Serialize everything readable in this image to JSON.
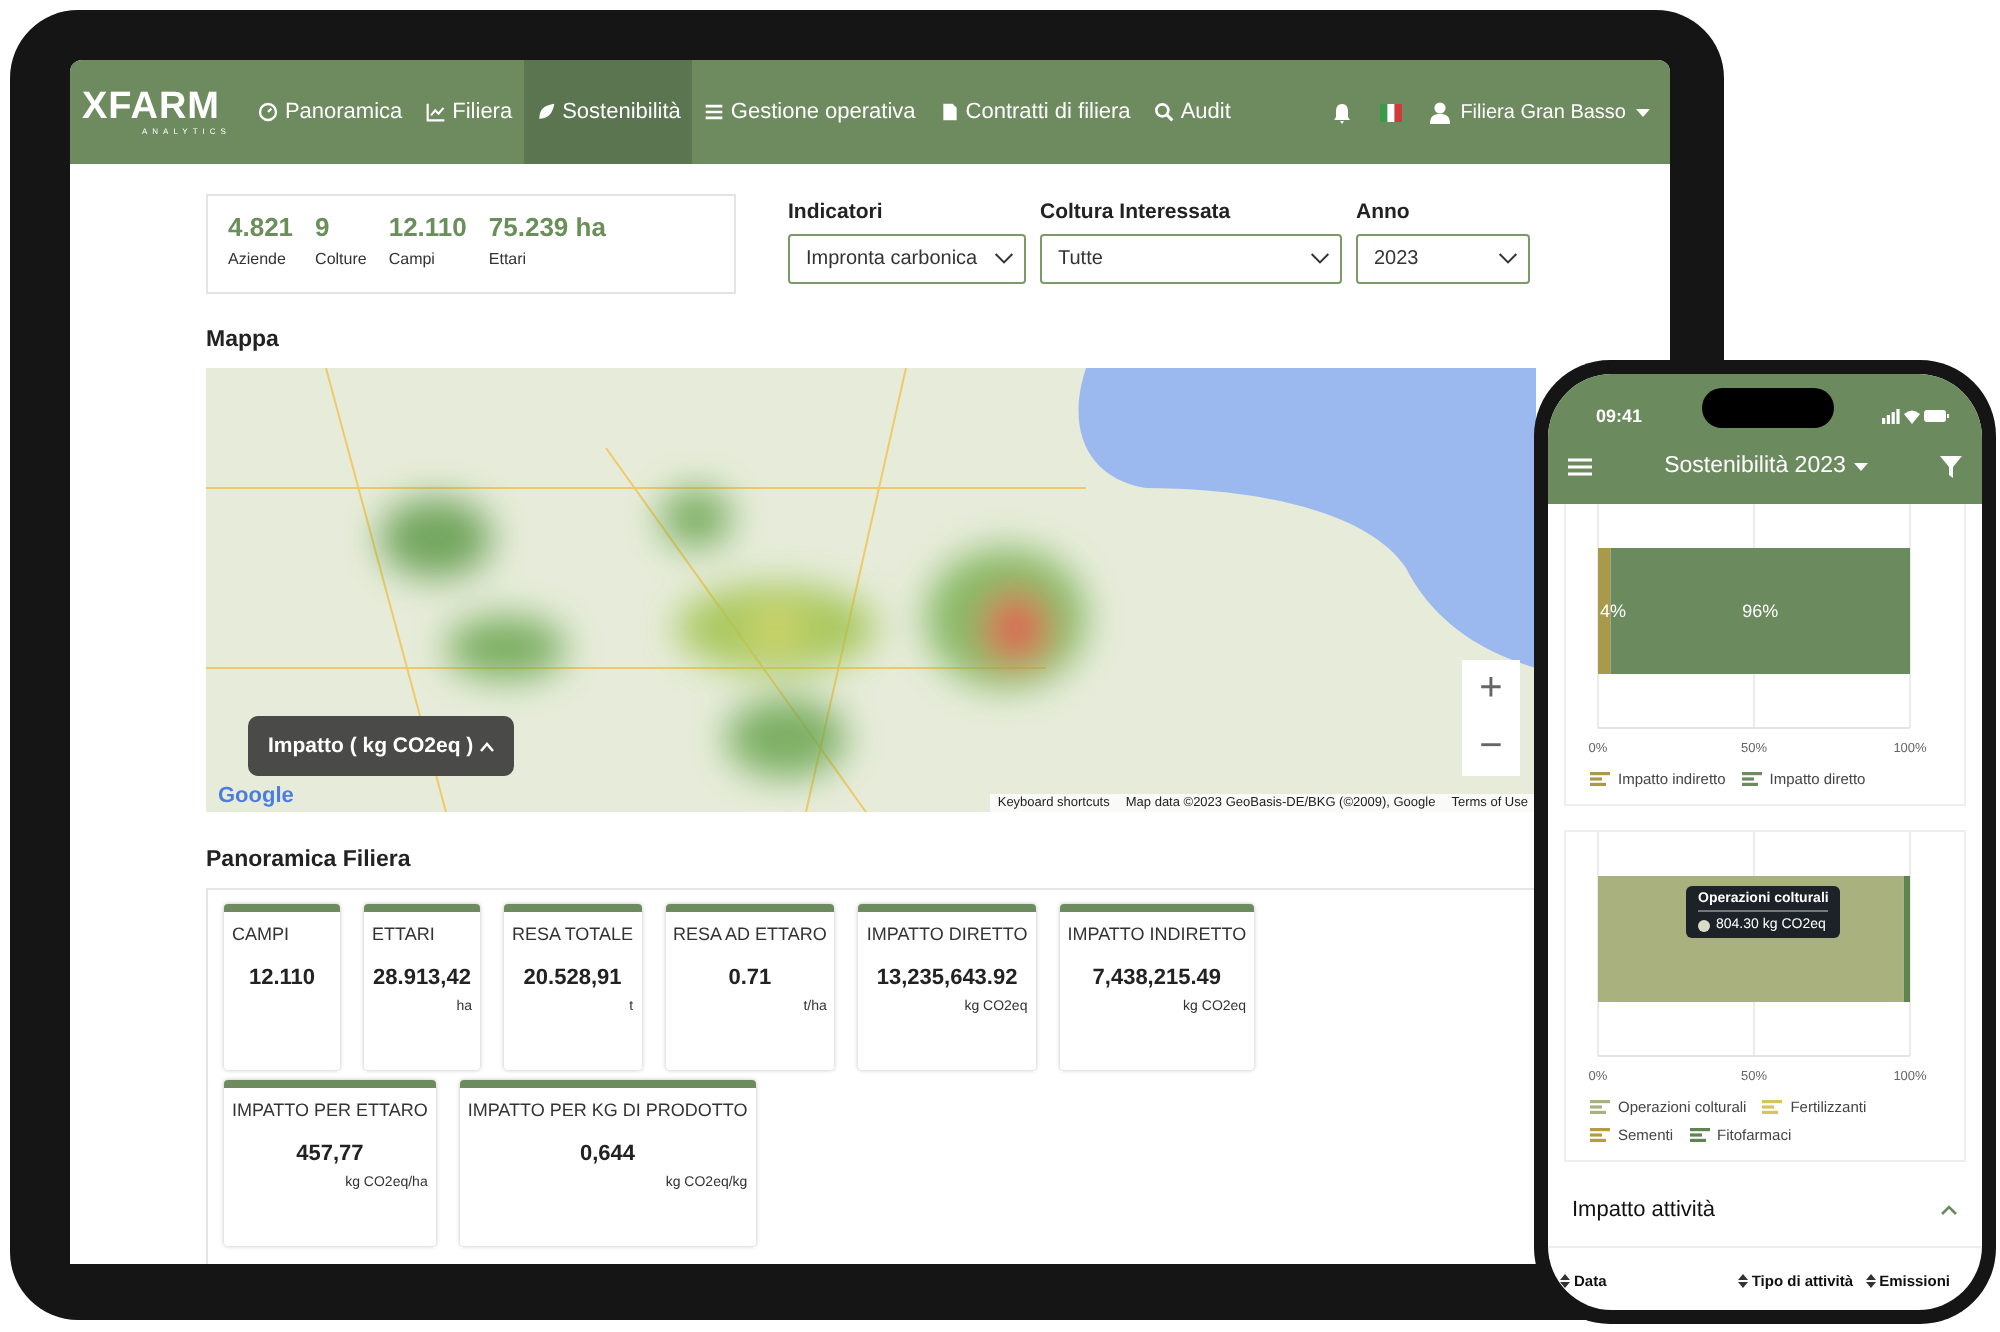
{
  "tablet": {
    "navbar": {
      "logo": "XFARM",
      "logo_sub": "ANALYTICS",
      "items": [
        {
          "label": "Panoramica",
          "selected": false
        },
        {
          "label": "Filiera",
          "selected": false
        },
        {
          "label": "Sostenibilità",
          "selected": true
        },
        {
          "label": "Gestione operativa",
          "selected": false
        },
        {
          "label": "Contratti di filiera",
          "selected": false
        },
        {
          "label": "Audit",
          "selected": false
        }
      ],
      "user": "Filiera Gran Basso"
    },
    "summary": [
      {
        "value": "4.821",
        "label": "Aziende"
      },
      {
        "value": "9",
        "label": "Colture"
      },
      {
        "value": "12.110",
        "label": "Campi"
      },
      {
        "value": "75.239 ha",
        "label": "Ettari"
      }
    ],
    "filters": [
      {
        "label": "Indicatori",
        "value": "Impronta carbonica"
      },
      {
        "label": "Coltura Interessata",
        "value": "Tutte"
      },
      {
        "label": "Anno",
        "value": "2023"
      }
    ],
    "map": {
      "title": "Mappa",
      "legend_button": "Impatto ( kg CO2eq )",
      "zoom_in": "+",
      "zoom_out": "−",
      "logo": "Google",
      "attribution": [
        "Keyboard shortcuts",
        "Map data ©2023 GeoBasis-DE/BKG (©2009), Google",
        "Terms of Use"
      ]
    },
    "overview": {
      "title": "Panoramica Filiera",
      "cards": [
        {
          "title": "CAMPI",
          "value": "12.110"
        },
        {
          "title": "ETTARI",
          "value": "28.913,42",
          "unit": "ha"
        },
        {
          "title": "RESA TOTALE",
          "value": "20.528,91",
          "unit": "t"
        },
        {
          "title": "RESA AD ETTARO",
          "value": "0.71",
          "unit": "t/ha"
        },
        {
          "title": "IMPATTO DIRETTO",
          "value": "13,235,643.92",
          "unit": "kg CO2eq"
        },
        {
          "title": "IMPATTO INDIRETTO",
          "value": "7,438,215.49",
          "unit": "kg CO2eq"
        },
        {
          "title": "IMPATTO PER ETTARO",
          "value": "457,77",
          "unit": "kg CO2eq/ha"
        },
        {
          "title": "IMPATTO PER KG DI PRODOTTO",
          "value": "0,644",
          "unit": "kg CO2eq/kg"
        }
      ]
    }
  },
  "phone": {
    "time": "09:41",
    "title": "Sostenibilità 2023",
    "charts": [
      {
        "chart_data": {
          "type": "bar",
          "orientation": "horizontal",
          "stacked": true,
          "value_labels": [
            "4%",
            "96%"
          ],
          "xlim": [
            0,
            100
          ],
          "xticks": [
            {
              "value": 0,
              "label": "0%"
            },
            {
              "value": 50,
              "label": "50%"
            },
            {
              "value": 100,
              "label": "100%"
            }
          ],
          "series": [
            {
              "name": "Impatto indiretto",
              "color": "#a89a4a",
              "values": [
                4
              ]
            },
            {
              "name": "Impatto diretto",
              "color": "#6b8a5e",
              "values": [
                96
              ]
            }
          ]
        }
      },
      {
        "chart_data": {
          "type": "bar",
          "orientation": "horizontal",
          "stacked": true,
          "xlim": [
            0,
            100
          ],
          "xticks": [
            {
              "value": 0,
              "label": "0%"
            },
            {
              "value": 50,
              "label": "50%"
            },
            {
              "value": 100,
              "label": "100%"
            }
          ],
          "series": [
            {
              "name": "Operazioni colturali",
              "color": "#a9b27f",
              "values": [
                98
              ]
            },
            {
              "name": "Fertilizzanti",
              "color": "#d6c45c",
              "values": [
                0
              ]
            },
            {
              "name": "Sementi",
              "color": "#b59d3e",
              "values": [
                0
              ]
            },
            {
              "name": "Fitofarmaci",
              "color": "#5e8451",
              "values": [
                2
              ]
            }
          ]
        },
        "tooltip": {
          "title": "Operazioni colturali",
          "value": "804.30 kg CO2eq"
        }
      }
    ],
    "section": {
      "title": "Impatto attività",
      "expanded": true,
      "columns": [
        "Data",
        "Tipo di attività",
        "Emissioni"
      ]
    }
  }
}
